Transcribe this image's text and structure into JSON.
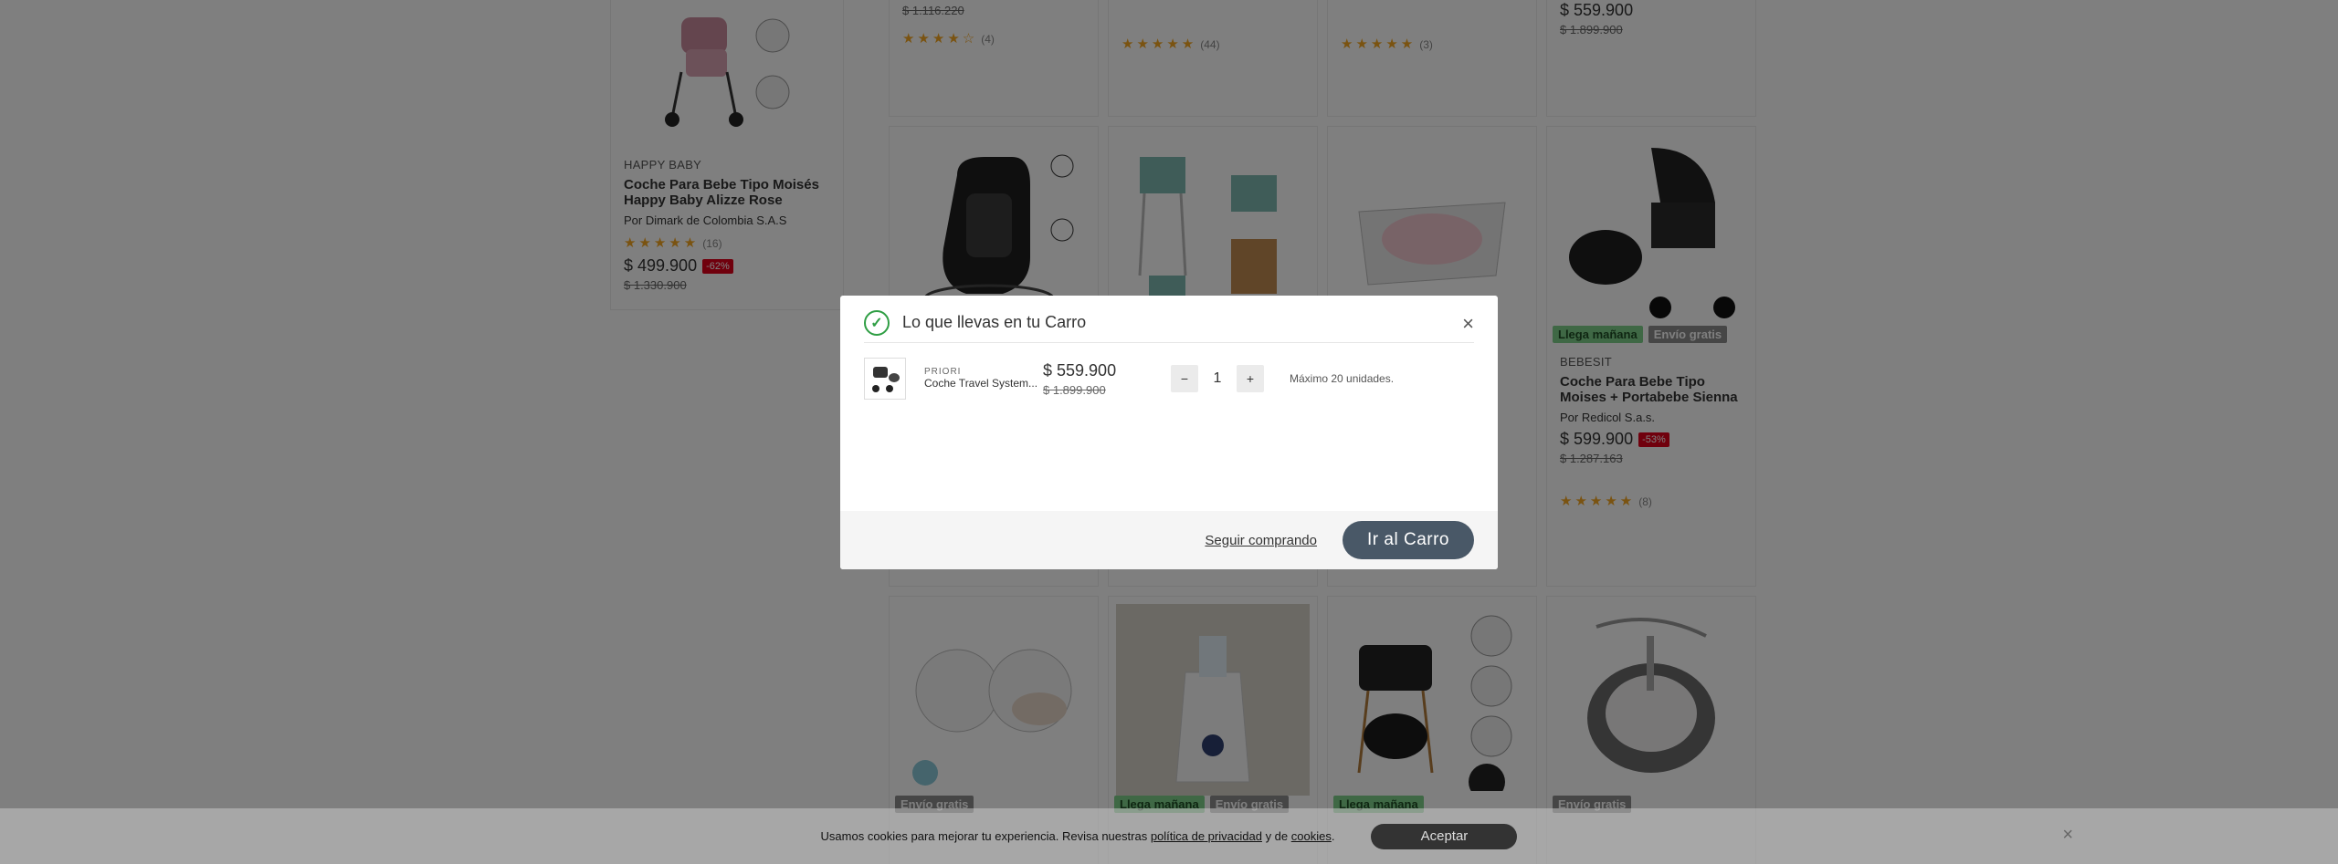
{
  "left_card": {
    "brand": "HAPPY BABY",
    "name": "Coche Para Bebe Tipo Moisés Happy Baby Alizze Rose",
    "seller": "Por Dimark de Colombia S.A.S",
    "stars": "★★★★★",
    "reviews": "(16)",
    "price": "$ 499.900",
    "discount": "-62%",
    "old_price": "$ 1.330.900"
  },
  "top_row": [
    {
      "old_price": "$ 1.116.220",
      "stars": "★★★★☆",
      "reviews": "(4)"
    },
    {
      "stars": "★★★★★",
      "reviews": "(44)"
    },
    {
      "stars": "★★★★★",
      "reviews": "(3)"
    },
    {
      "price": "$ 559.900",
      "old_price": "$ 1.899.900"
    }
  ],
  "mid_right_card": {
    "tag1": "Llega mañana",
    "tag2": "Envío gratis",
    "brand": "BEBESIT",
    "name": "Coche Para Bebe Tipo Moises + Portabebe Sienna",
    "seller": "Por Redicol S.a.s.",
    "price": "$ 599.900",
    "discount": "-53%",
    "old_price": "$ 1.287.163",
    "stars": "★★★★★",
    "reviews": "(8)"
  },
  "bottom_row_tags": [
    {
      "tag1": "Envío gratis"
    },
    {
      "tag1": "Llega mañana",
      "tag2": "Envío gratis"
    },
    {
      "tag1": "Llega mañana"
    },
    {
      "tag1": "Envío gratis"
    }
  ],
  "modal": {
    "title": "Lo que llevas en tu Carro",
    "close_icon": "×",
    "item": {
      "brand": "PRIORI",
      "name": "Coche Travel System...",
      "price": "$ 559.900",
      "old_price": "$ 1.899.900",
      "quantity": "1",
      "minus": "−",
      "plus": "+",
      "max_note": "Máximo 20 unidades."
    },
    "continue_label": "Seguir comprando",
    "cart_label": "Ir al Carro"
  },
  "cookie": {
    "text_before": "Usamos cookies para mejorar tu experiencia. Revisa nuestras ",
    "privacy_link": "política de privacidad",
    "text_middle": " y de ",
    "cookies_link": "cookies",
    "text_end": ".",
    "accept": "Aceptar",
    "close_icon": "×"
  },
  "colors": {
    "accent_button": "#495867",
    "discount_badge": "#e0001a",
    "star": "#f5a623",
    "success": "#2f9e44"
  }
}
